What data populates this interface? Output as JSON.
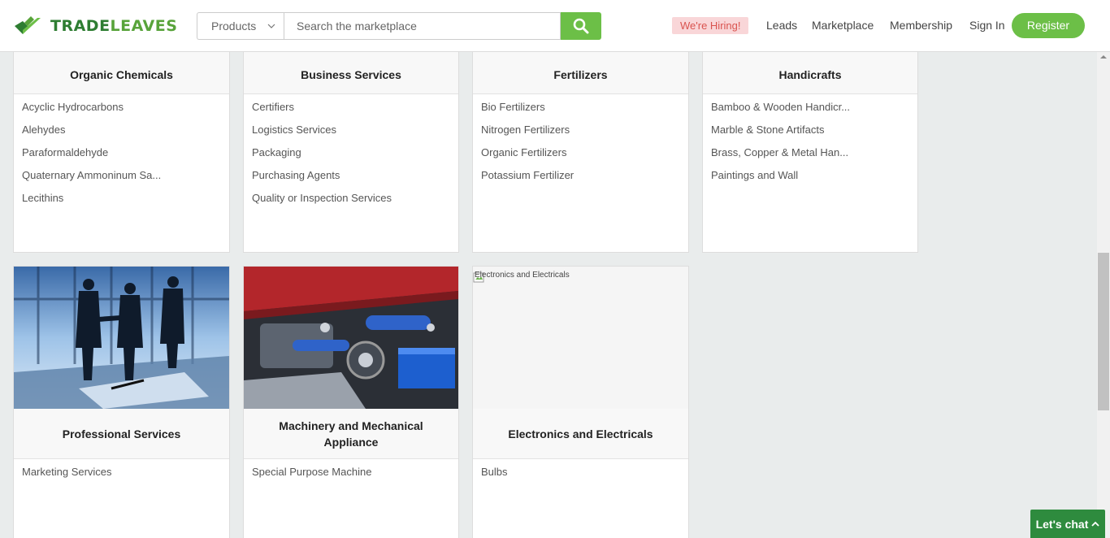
{
  "header": {
    "logo_text_1": "TRADE",
    "logo_text_2": "LEAVES",
    "search_category": "Products",
    "search_placeholder": "Search the marketplace",
    "hiring_label": "We're Hiring!",
    "nav": [
      "Leads",
      "Marketplace",
      "Membership",
      "Sign In"
    ],
    "register_label": "Register"
  },
  "cards_top": [
    {
      "title": "Organic Chemicals",
      "items": [
        "Acyclic Hydrocarbons",
        "Alehydes",
        "Paraformaldehyde",
        "Quaternary Ammoninum Sa...",
        "Lecithins"
      ]
    },
    {
      "title": "Business Services",
      "items": [
        "Certifiers",
        "Logistics Services",
        "Packaging",
        "Purchasing Agents",
        "Quality or Inspection Services"
      ]
    },
    {
      "title": "Fertilizers",
      "items": [
        "Bio Fertilizers",
        "Nitrogen Fertilizers",
        "Organic Fertilizers",
        "Potassium Fertilizer"
      ]
    },
    {
      "title": "Handicrafts",
      "items": [
        "Bamboo & Wooden Handicr...",
        "Marble & Stone Artifacts",
        "Brass, Copper & Metal Han...",
        "Paintings and Wall"
      ]
    }
  ],
  "cards_bottom": [
    {
      "title": "Professional Services",
      "image": "business-handshake-photo",
      "items": [
        "Marketing Services"
      ]
    },
    {
      "title": "Machinery and Mechanical Appliance",
      "image": "car-engine-photo",
      "items": [
        "Special Purpose Machine"
      ]
    },
    {
      "title": "Electronics and Electricals",
      "image_alt": "Electronics and Electricals",
      "items": [
        "Bulbs"
      ]
    }
  ],
  "chat_label": "Let's chat",
  "colors": {
    "brand_green": "#6cbf47",
    "dark_green": "#2e7d32",
    "chat_green": "#2e8b3e",
    "hiring_bg": "#f9d6d8",
    "hiring_text": "#d9534f"
  }
}
